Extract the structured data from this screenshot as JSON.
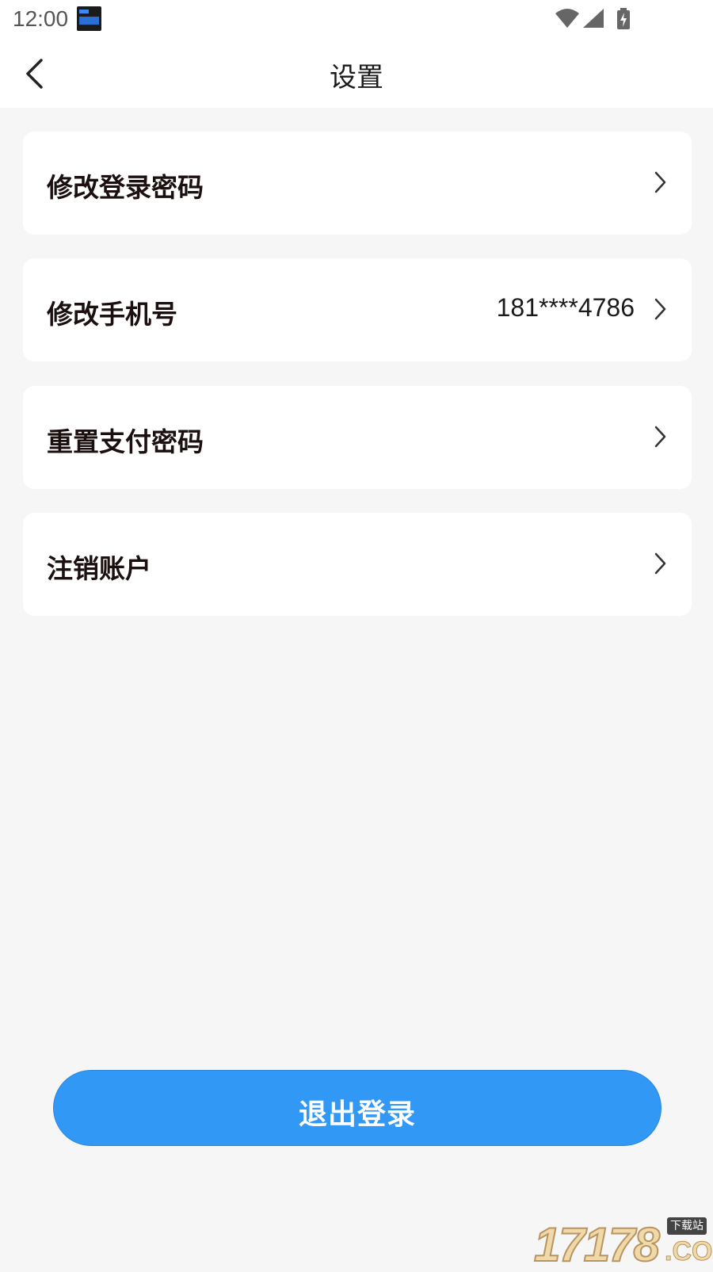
{
  "status_bar": {
    "time": "12:00",
    "icons": [
      "app-notification-icon",
      "wifi-icon",
      "cellular-signal-icon",
      "battery-charging-icon"
    ]
  },
  "header": {
    "title": "设置",
    "back_icon": "chevron-left-icon"
  },
  "settings": {
    "items": [
      {
        "label": "修改登录密码",
        "value": ""
      },
      {
        "label": "修改手机号",
        "value": "181****4786"
      },
      {
        "label": "重置支付密码",
        "value": ""
      },
      {
        "label": "注销账户",
        "value": ""
      }
    ],
    "chevron_icon": "chevron-right-icon"
  },
  "logout": {
    "label": "退出登录"
  },
  "colors": {
    "background": "#f6f6f7",
    "card": "#ffffff",
    "primary": "#3198f6",
    "text": "#1b0f10"
  },
  "watermark": {
    "number": "17178",
    "tag": "下载站",
    "domain": ".COM"
  }
}
